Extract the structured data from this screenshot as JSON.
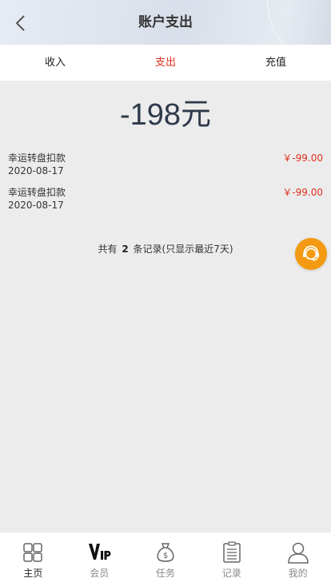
{
  "header": {
    "title": "账户支出"
  },
  "tabs": [
    {
      "label": "收入",
      "active": false
    },
    {
      "label": "支出",
      "active": true
    },
    {
      "label": "充值",
      "active": false
    }
  ],
  "total": "-198元",
  "records": [
    {
      "name": "幸运转盘扣款",
      "date": "2020-08-17",
      "amount": "￥-99.00"
    },
    {
      "name": "幸运转盘扣款",
      "date": "2020-08-17",
      "amount": "￥-99.00"
    }
  ],
  "summary": {
    "prefix": "共有",
    "count": "2",
    "suffix": "条记录(只显示最近7天)"
  },
  "bottom_nav": [
    {
      "label": "主页",
      "icon": "grid-icon",
      "active": true
    },
    {
      "label": "会员",
      "icon": "vip-icon",
      "active": false
    },
    {
      "label": "任务",
      "icon": "money-bag-icon",
      "active": false
    },
    {
      "label": "记录",
      "icon": "clipboard-icon",
      "active": false
    },
    {
      "label": "我的",
      "icon": "user-icon",
      "active": false
    }
  ],
  "colors": {
    "accent_red": "#e0301e",
    "service_orange": "#f39a12",
    "background": "#ececec"
  }
}
